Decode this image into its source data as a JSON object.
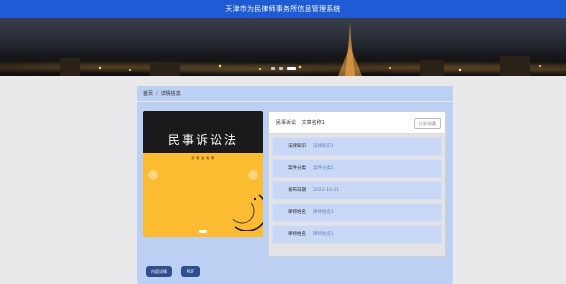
{
  "header": {
    "title": "天津市为民律师事务所信息管理系统"
  },
  "breadcrumb": {
    "home": "首页",
    "separator": "/",
    "current": "详情信息"
  },
  "book": {
    "cover_title": "民事诉讼法",
    "cover_subtitle": "张 明 进 等 著"
  },
  "details": {
    "kind": "民事诉讼",
    "case_name": "文章名称1",
    "category_button": "分享/收藏",
    "rows": [
      {
        "label": "法律知识",
        "value": "法律知识1"
      },
      {
        "label": "案件分类",
        "value": "案件分类1"
      },
      {
        "label": "发布日期",
        "value": "2022-10-21"
      },
      {
        "label": "律师姓名",
        "value": "律师姓名1"
      },
      {
        "label": "律师姓名",
        "value": "律师姓名1"
      }
    ]
  },
  "actions": {
    "expand_label": "内容详情",
    "pdf_label": "PDF"
  },
  "colors": {
    "topbar": "#1f5bd4",
    "panel": "#bcd0f3",
    "book_top": "#1a1a1a",
    "book_bottom": "#fbbc32",
    "button": "#2f4e8f"
  }
}
